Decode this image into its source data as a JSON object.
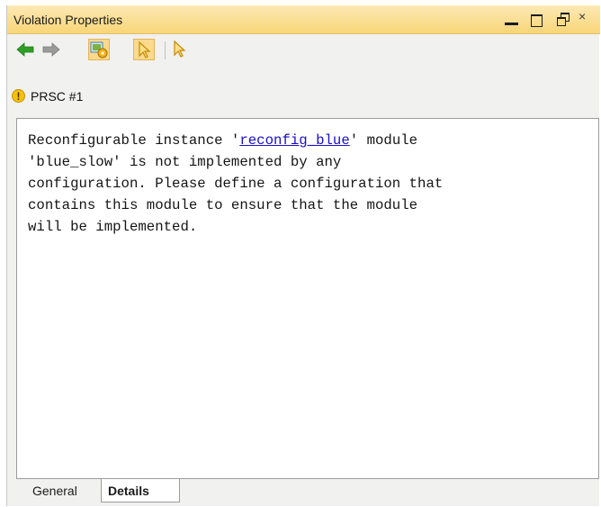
{
  "window": {
    "title": "Violation Properties",
    "controls": [
      "minimize",
      "maximize",
      "restore",
      "close"
    ],
    "close_glyph": "×"
  },
  "toolbar": {
    "icons": [
      "back-arrow-icon",
      "forward-arrow-icon",
      "select-settings-icon",
      "select-pointer-icon",
      "pointer-icon"
    ]
  },
  "violation": {
    "id": "PRSC #1",
    "severity_icon": "warning-icon",
    "severity_glyph": "!"
  },
  "details": {
    "message_before_link": "Reconfigurable instance '",
    "link_text": "reconfig_blue",
    "message_after_link": "' module\n'blue_slow' is not implemented by any\nconfiguration. Please define a configuration that\ncontains this module to ensure that the module\nwill be implemented."
  },
  "tabs": [
    {
      "label": "General",
      "selected": false
    },
    {
      "label": "Details",
      "selected": true
    }
  ],
  "colors": {
    "titlebar": "#f8d577",
    "link": "#1a0dcc",
    "warning": "#f6c10c",
    "back_arrow": "#2e9f25",
    "forward_arrow": "#8c8c8c"
  }
}
